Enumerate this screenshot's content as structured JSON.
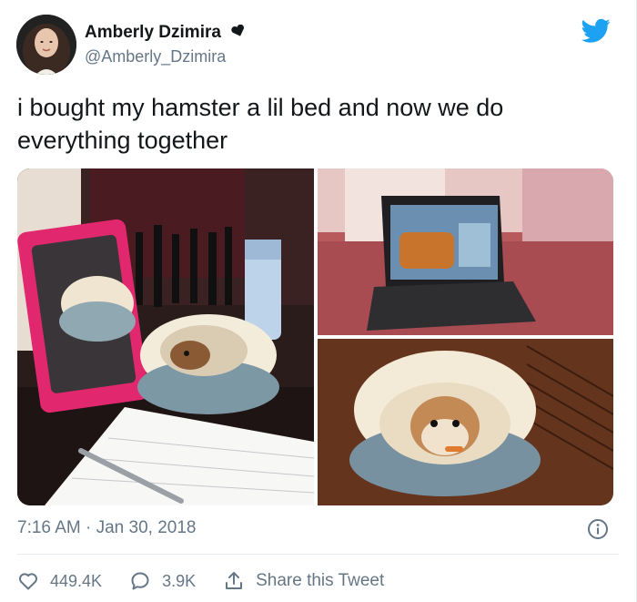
{
  "user": {
    "display_name": "Amberly Dzimira",
    "handle": "@Amberly_Dzimira"
  },
  "tweet": {
    "text": "i bought my hamster a lil bed and now we do\neverything together",
    "timestamp": "7:16 AM · Jan 30, 2018"
  },
  "actions": {
    "likes": "449.4K",
    "replies": "3.9K",
    "share_label": "Share this Tweet"
  },
  "icons": {
    "badge": "heart-emoji-icon",
    "brand": "twitter-bird-icon",
    "info": "info-icon",
    "like": "heart-icon",
    "reply": "reply-icon",
    "share": "share-icon"
  },
  "colors": {
    "twitter_blue": "#1da1f2",
    "secondary_text": "#657786",
    "primary_text": "#14171a"
  }
}
